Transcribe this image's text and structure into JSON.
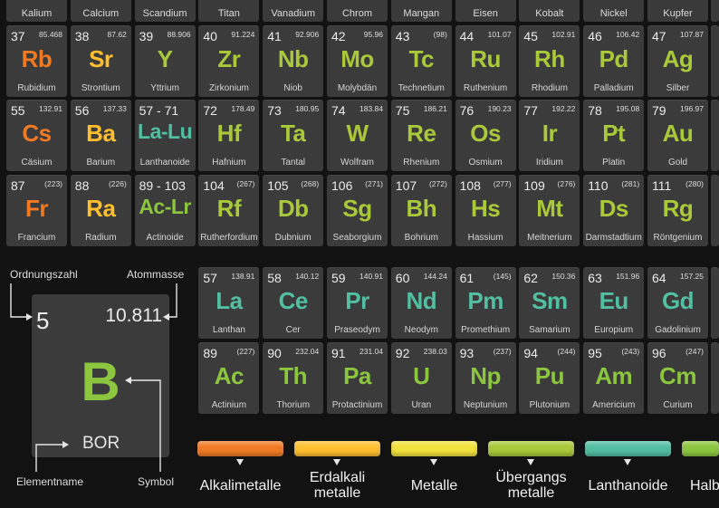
{
  "colors": {
    "alkali": "#f07a24",
    "alkaline": "#ffbf2f",
    "metal": "#f2e23c",
    "transition": "#a9c93a",
    "lanthanide": "#52bfa2",
    "actinide": "#8cc63f",
    "bor": "#8cc63f"
  },
  "headers": [
    "Kalium",
    "Calcium",
    "Scandium",
    "Titan",
    "Vanadium",
    "Chrom",
    "Mangan",
    "Eisen",
    "Kobalt",
    "Nickel",
    "Kupfer"
  ],
  "rows": [
    [
      {
        "num": "37",
        "mass": "85.468",
        "sym": "Rb",
        "name": "Rubidium",
        "color": "alkali"
      },
      {
        "num": "38",
        "mass": "87.62",
        "sym": "Sr",
        "name": "Strontium",
        "color": "alkaline"
      },
      {
        "num": "39",
        "mass": "88.906",
        "sym": "Y",
        "name": "Yttrium",
        "color": "transition"
      },
      {
        "num": "40",
        "mass": "91.224",
        "sym": "Zr",
        "name": "Zirkonium",
        "color": "transition"
      },
      {
        "num": "41",
        "mass": "92.906",
        "sym": "Nb",
        "name": "Niob",
        "color": "transition"
      },
      {
        "num": "42",
        "mass": "95.96",
        "sym": "Mo",
        "name": "Molybdän",
        "color": "transition"
      },
      {
        "num": "43",
        "mass": "(98)",
        "sym": "Tc",
        "name": "Technetium",
        "color": "transition"
      },
      {
        "num": "44",
        "mass": "101.07",
        "sym": "Ru",
        "name": "Ruthenium",
        "color": "transition"
      },
      {
        "num": "45",
        "mass": "102.91",
        "sym": "Rh",
        "name": "Rhodium",
        "color": "transition"
      },
      {
        "num": "46",
        "mass": "106.42",
        "sym": "Pd",
        "name": "Palladium",
        "color": "transition"
      },
      {
        "num": "47",
        "mass": "107.87",
        "sym": "Ag",
        "name": "Silber",
        "color": "transition"
      }
    ],
    [
      {
        "num": "55",
        "mass": "132.91",
        "sym": "Cs",
        "name": "Cäsium",
        "color": "alkali"
      },
      {
        "num": "56",
        "mass": "137.33",
        "sym": "Ba",
        "name": "Barium",
        "color": "alkaline"
      },
      {
        "num": "57 - 71",
        "mass": "",
        "sym": "La-Lu",
        "name": "Lanthanoide",
        "color": "lanthanide"
      },
      {
        "num": "72",
        "mass": "178.49",
        "sym": "Hf",
        "name": "Hafnium",
        "color": "transition"
      },
      {
        "num": "73",
        "mass": "180.95",
        "sym": "Ta",
        "name": "Tantal",
        "color": "transition"
      },
      {
        "num": "74",
        "mass": "183.84",
        "sym": "W",
        "name": "Wolfram",
        "color": "transition"
      },
      {
        "num": "75",
        "mass": "186.21",
        "sym": "Re",
        "name": "Rhenium",
        "color": "transition"
      },
      {
        "num": "76",
        "mass": "190.23",
        "sym": "Os",
        "name": "Osmium",
        "color": "transition"
      },
      {
        "num": "77",
        "mass": "192.22",
        "sym": "Ir",
        "name": "Iridium",
        "color": "transition"
      },
      {
        "num": "78",
        "mass": "195.08",
        "sym": "Pt",
        "name": "Platin",
        "color": "transition"
      },
      {
        "num": "79",
        "mass": "196.97",
        "sym": "Au",
        "name": "Gold",
        "color": "transition"
      }
    ],
    [
      {
        "num": "87",
        "mass": "(223)",
        "sym": "Fr",
        "name": "Francium",
        "color": "alkali"
      },
      {
        "num": "88",
        "mass": "(226)",
        "sym": "Ra",
        "name": "Radium",
        "color": "alkaline"
      },
      {
        "num": "89 - 103",
        "mass": "",
        "sym": "Ac-Lr",
        "name": "Actinoide",
        "color": "actinide"
      },
      {
        "num": "104",
        "mass": "(267)",
        "sym": "Rf",
        "name": "Rutherfordium",
        "color": "transition"
      },
      {
        "num": "105",
        "mass": "(268)",
        "sym": "Db",
        "name": "Dubnium",
        "color": "transition"
      },
      {
        "num": "106",
        "mass": "(271)",
        "sym": "Sg",
        "name": "Seaborgium",
        "color": "transition"
      },
      {
        "num": "107",
        "mass": "(272)",
        "sym": "Bh",
        "name": "Bohrium",
        "color": "transition"
      },
      {
        "num": "108",
        "mass": "(277)",
        "sym": "Hs",
        "name": "Hassium",
        "color": "transition"
      },
      {
        "num": "109",
        "mass": "(276)",
        "sym": "Mt",
        "name": "Meitnerium",
        "color": "transition"
      },
      {
        "num": "110",
        "mass": "(281)",
        "sym": "Ds",
        "name": "Darmstadtium",
        "color": "transition"
      },
      {
        "num": "111",
        "mass": "(280)",
        "sym": "Rg",
        "name": "Röntgenium",
        "color": "transition"
      }
    ]
  ],
  "lanthanides": [
    {
      "num": "57",
      "mass": "138.91",
      "sym": "La",
      "name": "Lanthan",
      "color": "lanthanide"
    },
    {
      "num": "58",
      "mass": "140.12",
      "sym": "Ce",
      "name": "Cer",
      "color": "lanthanide"
    },
    {
      "num": "59",
      "mass": "140.91",
      "sym": "Pr",
      "name": "Praseodym",
      "color": "lanthanide"
    },
    {
      "num": "60",
      "mass": "144.24",
      "sym": "Nd",
      "name": "Neodym",
      "color": "lanthanide"
    },
    {
      "num": "61",
      "mass": "(145)",
      "sym": "Pm",
      "name": "Promethium",
      "color": "lanthanide"
    },
    {
      "num": "62",
      "mass": "150.36",
      "sym": "Sm",
      "name": "Samarium",
      "color": "lanthanide"
    },
    {
      "num": "63",
      "mass": "151.96",
      "sym": "Eu",
      "name": "Europium",
      "color": "lanthanide"
    },
    {
      "num": "64",
      "mass": "157.25",
      "sym": "Gd",
      "name": "Gadolinium",
      "color": "lanthanide"
    }
  ],
  "actinides": [
    {
      "num": "89",
      "mass": "(227)",
      "sym": "Ac",
      "name": "Actinium",
      "color": "actinide"
    },
    {
      "num": "90",
      "mass": "232.04",
      "sym": "Th",
      "name": "Thorium",
      "color": "actinide"
    },
    {
      "num": "91",
      "mass": "231.04",
      "sym": "Pa",
      "name": "Protactinium",
      "color": "actinide"
    },
    {
      "num": "92",
      "mass": "238.03",
      "sym": "U",
      "name": "Uran",
      "color": "actinide"
    },
    {
      "num": "93",
      "mass": "(237)",
      "sym": "Np",
      "name": "Neptunium",
      "color": "actinide"
    },
    {
      "num": "94",
      "mass": "(244)",
      "sym": "Pu",
      "name": "Plutonium",
      "color": "actinide"
    },
    {
      "num": "95",
      "mass": "(243)",
      "sym": "Am",
      "name": "Americium",
      "color": "actinide"
    },
    {
      "num": "96",
      "mass": "(247)",
      "sym": "Cm",
      "name": "Curium",
      "color": "actinide"
    }
  ],
  "key": {
    "num": "5",
    "mass": "10.811",
    "sym": "B",
    "name": "BOR",
    "label_number": "Ordnungszahl",
    "label_mass": "Atommasse",
    "label_name": "Elementname",
    "label_symbol": "Symbol"
  },
  "legend": [
    {
      "line1": "Alkalimetalle",
      "line2": "",
      "color": "alkali"
    },
    {
      "line1": "Erdalkali",
      "line2": "metalle",
      "color": "alkaline"
    },
    {
      "line1": "Metalle",
      "line2": "",
      "color": "metal"
    },
    {
      "line1": "Übergangs",
      "line2": "metalle",
      "color": "transition"
    },
    {
      "line1": "Lanthanoide",
      "line2": "",
      "color": "lanthanide"
    },
    {
      "line1": "Halbu",
      "line2": "",
      "color": "actinide"
    }
  ]
}
